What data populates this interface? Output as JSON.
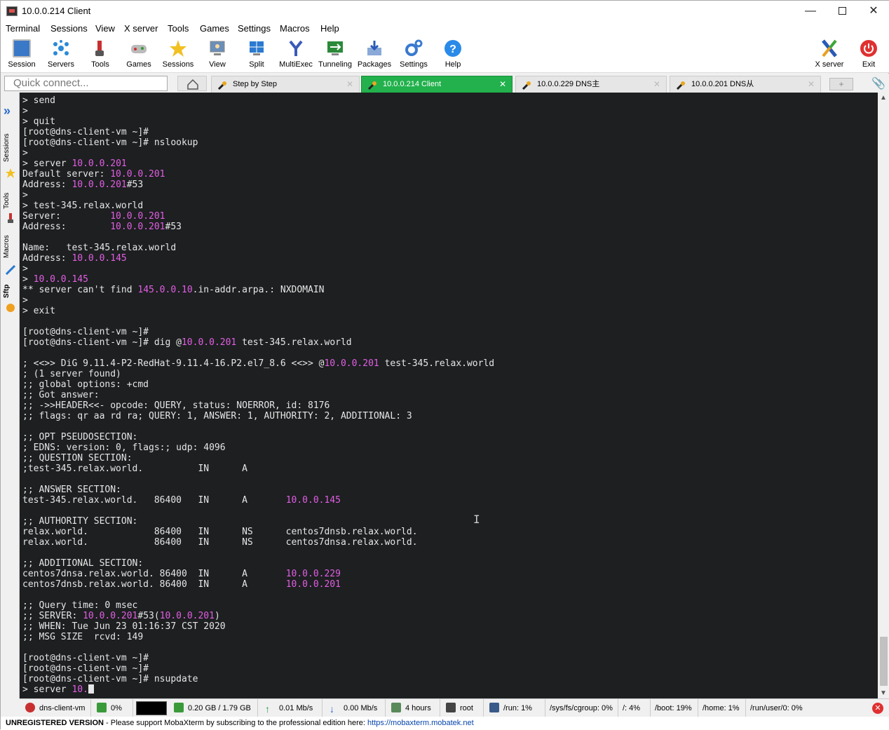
{
  "window": {
    "title": "10.0.0.214 Client"
  },
  "menu": [
    "Terminal",
    "Sessions",
    "View",
    "X server",
    "Tools",
    "Games",
    "Settings",
    "Macros",
    "Help"
  ],
  "toolbar": {
    "buttons": [
      "Session",
      "Servers",
      "Tools",
      "Games",
      "Sessions",
      "View",
      "Split",
      "MultiExec",
      "Tunneling",
      "Packages",
      "Settings",
      "Help"
    ],
    "right_buttons": [
      "X server",
      "Exit"
    ]
  },
  "quick_connect": {
    "placeholder": "Quick connect..."
  },
  "tabs": [
    {
      "label": "Step by Step",
      "active": false
    },
    {
      "label": "10.0.0.214 Client",
      "active": true
    },
    {
      "label": "10.0.0.229 DNS主",
      "active": false
    },
    {
      "label": "10.0.0.201 DNS从",
      "active": false
    }
  ],
  "sidebar": {
    "tabs": [
      "Sessions",
      "Tools",
      "Macros",
      "Sftp"
    ]
  },
  "terminal": {
    "highlight_color": "#e35ee3",
    "lines": [
      "> send",
      ">",
      "> quit",
      "[root@dns-client-vm ~]#",
      "[root@dns-client-vm ~]# nslookup",
      ">",
      "> server 10.0.0.201",
      "Default server: 10.0.0.201",
      "Address: 10.0.0.201#53",
      ">",
      "> test-345.relax.world",
      "Server:         10.0.0.201",
      "Address:        10.0.0.201#53",
      "",
      "Name:   test-345.relax.world",
      "Address: 10.0.0.145",
      ">",
      "> 10.0.0.145",
      "** server can't find 145.0.0.10.in-addr.arpa.: NXDOMAIN",
      ">",
      "> exit",
      "",
      "[root@dns-client-vm ~]#",
      "[root@dns-client-vm ~]# dig @10.0.0.201 test-345.relax.world",
      "",
      "; <<>> DiG 9.11.4-P2-RedHat-9.11.4-16.P2.el7_8.6 <<>> @10.0.0.201 test-345.relax.world",
      "; (1 server found)",
      ";; global options: +cmd",
      ";; Got answer:",
      ";; ->>HEADER<<- opcode: QUERY, status: NOERROR, id: 8176",
      ";; flags: qr aa rd ra; QUERY: 1, ANSWER: 1, AUTHORITY: 2, ADDITIONAL: 3",
      "",
      ";; OPT PSEUDOSECTION:",
      "; EDNS: version: 0, flags:; udp: 4096",
      ";; QUESTION SECTION:",
      ";test-345.relax.world.          IN      A",
      "",
      ";; ANSWER SECTION:",
      "test-345.relax.world.   86400   IN      A       10.0.0.145",
      "",
      ";; AUTHORITY SECTION:",
      "relax.world.            86400   IN      NS      centos7dnsb.relax.world.",
      "relax.world.            86400   IN      NS      centos7dnsa.relax.world.",
      "",
      ";; ADDITIONAL SECTION:",
      "centos7dnsa.relax.world. 86400  IN      A       10.0.0.229",
      "centos7dnsb.relax.world. 86400  IN      A       10.0.0.201",
      "",
      ";; Query time: 0 msec",
      ";; SERVER: 10.0.0.201#53(10.0.0.201)",
      ";; WHEN: Tue Jun 23 01:16:37 CST 2020",
      ";; MSG SIZE  rcvd: 149",
      "",
      "[root@dns-client-vm ~]#",
      "[root@dns-client-vm ~]#",
      "[root@dns-client-vm ~]# nsupdate",
      "> server 10."
    ]
  },
  "status": {
    "host": "dns-client-vm",
    "cpu": "0%",
    "memory": "0.20 GB / 1.79 GB",
    "upload": "0.01 Mb/s",
    "download": "0.00 Mb/s",
    "uptime": "4 hours",
    "user": "root",
    "disks": [
      "/run: 1%",
      "/sys/fs/cgroup: 0%",
      "/: 4%",
      "/boot: 19%",
      "/home: 1%",
      "/run/user/0: 0%"
    ]
  },
  "footer": {
    "unregistered": "UNREGISTERED VERSION",
    "message": "  -  Please support MobaXterm by subscribing to the professional edition here: ",
    "link": "https://mobaxterm.mobatek.net"
  }
}
